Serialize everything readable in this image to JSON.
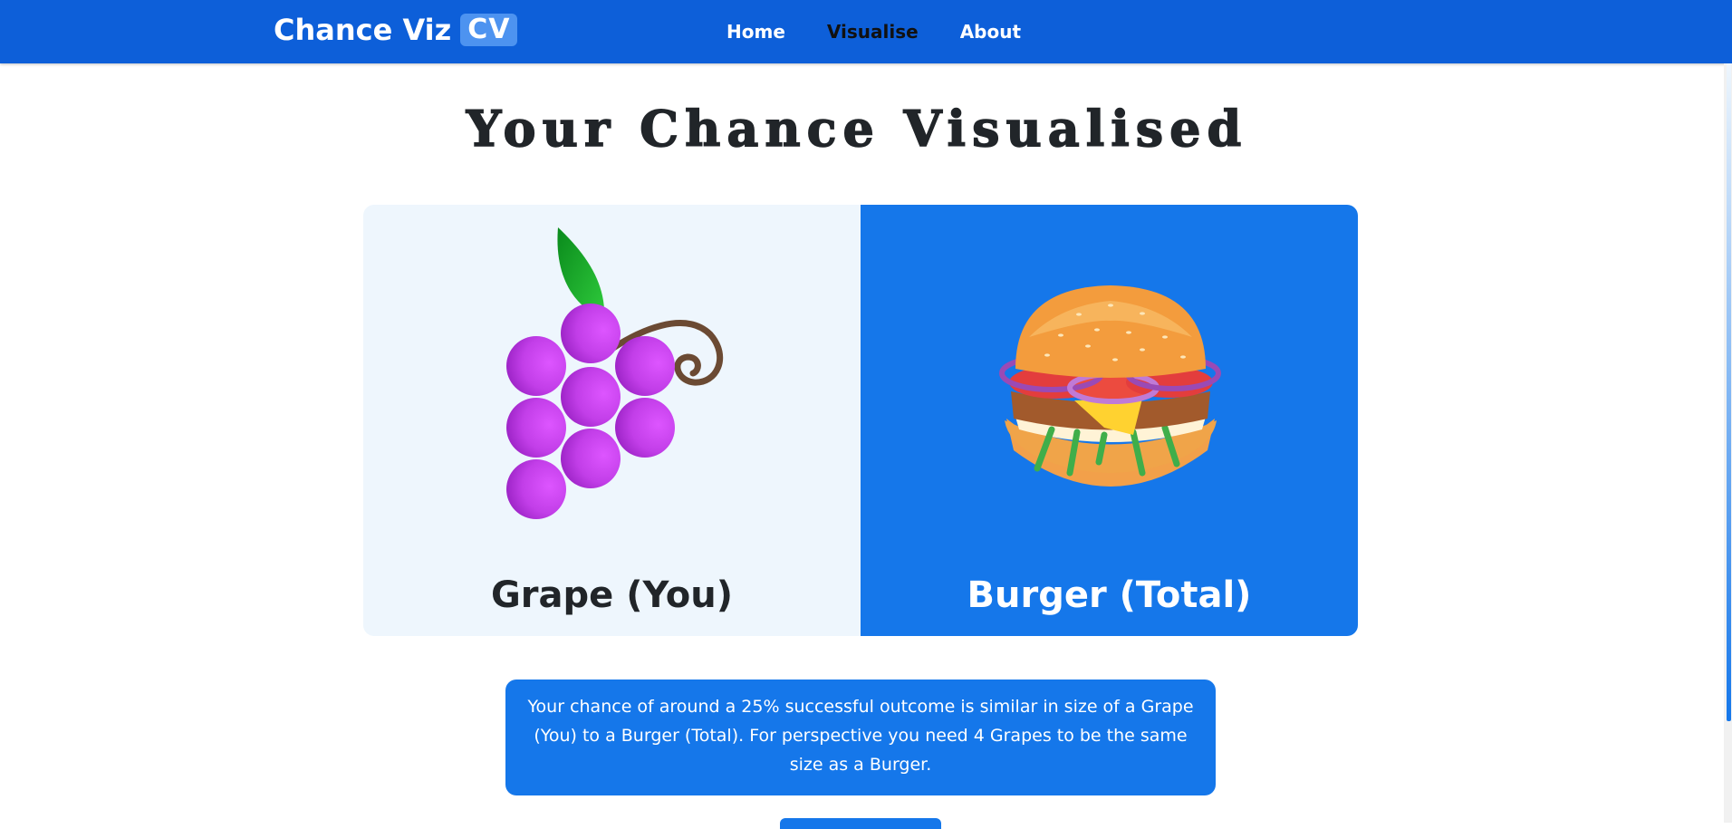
{
  "nav": {
    "brand": "Chance Viz",
    "brand_badge": "CV",
    "links": [
      "Home",
      "Visualise",
      "About"
    ],
    "active": "Visualise"
  },
  "main": {
    "title": "Your Chance Visualised",
    "left_panel": {
      "label": "Grape (You)",
      "icon": "grape-icon",
      "bg": "#eef6fd"
    },
    "right_panel": {
      "label": "Burger (Total)",
      "icon": "burger-icon",
      "bg": "#1577ea"
    },
    "info_text": "Your chance of around a 25% successful outcome is similar in size of a Grape (You) to a Burger (Total). For perspective you need 4 Grapes to be the same size as a Burger."
  },
  "colors": {
    "navbar": "#0d5fd9",
    "accent": "#1577ea",
    "grape": "#c23ee8",
    "leaf": "#1bab2a"
  }
}
